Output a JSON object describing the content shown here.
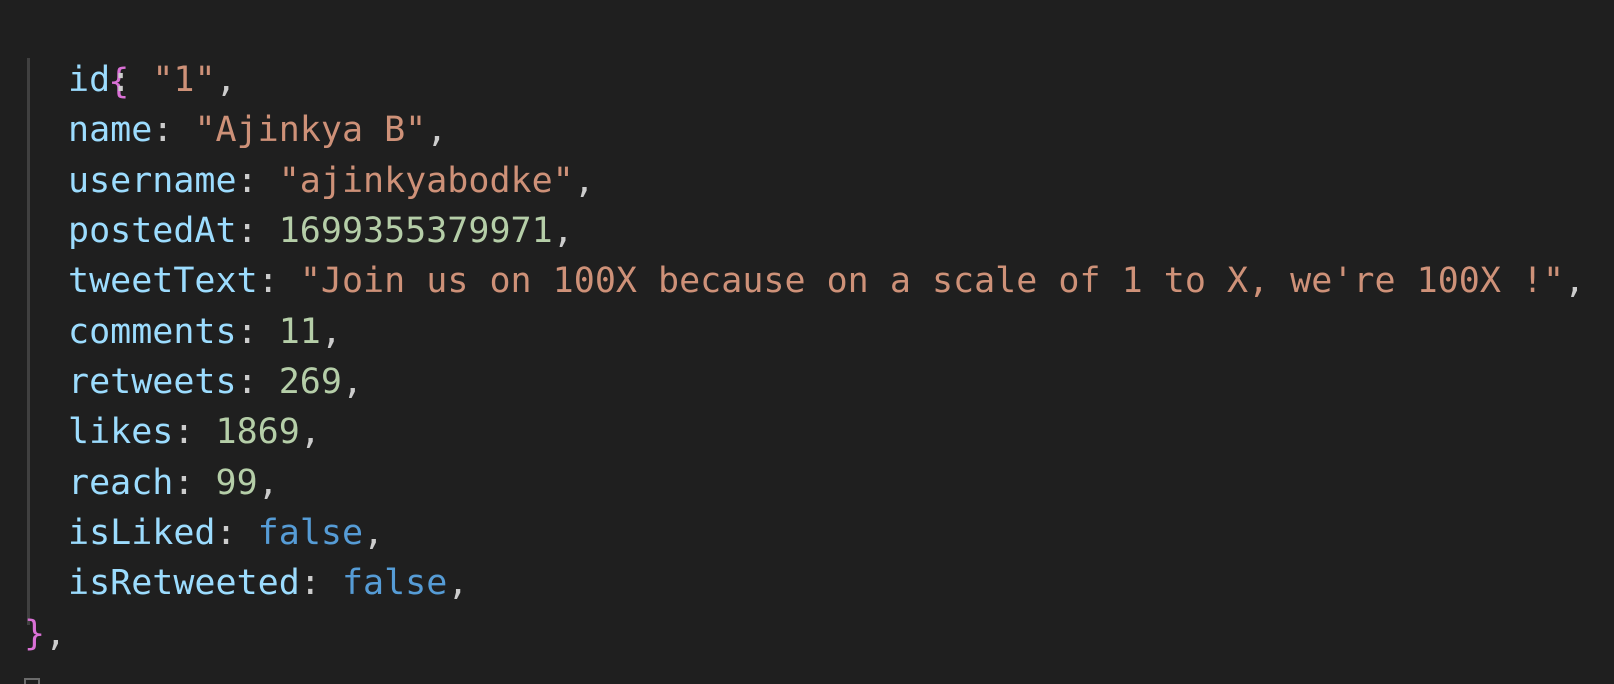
{
  "colors": {
    "background": "#1f1f1f",
    "key": "#9cdcfe",
    "string": "#ce9178",
    "number": "#b5cea8",
    "boolean": "#569cd6",
    "brace": "#da70d6",
    "punctuation": "#cccccc"
  },
  "code": {
    "open_brace": "{",
    "close_brace": "}",
    "trailing_comma": ",",
    "lines": [
      {
        "key": "id",
        "value": "\"1\"",
        "type": "string"
      },
      {
        "key": "name",
        "value": "\"Ajinkya B\"",
        "type": "string"
      },
      {
        "key": "username",
        "value": "\"ajinkyabodke\"",
        "type": "string"
      },
      {
        "key": "postedAt",
        "value": "1699355379971",
        "type": "number"
      },
      {
        "key": "tweetText",
        "value": "\"Join us on 100X because on a scale of 1 to X, we're 100X !\"",
        "type": "string"
      },
      {
        "key": "comments",
        "value": "11",
        "type": "number"
      },
      {
        "key": "retweets",
        "value": "269",
        "type": "number"
      },
      {
        "key": "likes",
        "value": "1869",
        "type": "number"
      },
      {
        "key": "reach",
        "value": "99",
        "type": "number"
      },
      {
        "key": "isLiked",
        "value": "false",
        "type": "boolean"
      },
      {
        "key": "isRetweeted",
        "value": "false",
        "type": "boolean"
      }
    ],
    "colon": ": ",
    "comma": ","
  }
}
